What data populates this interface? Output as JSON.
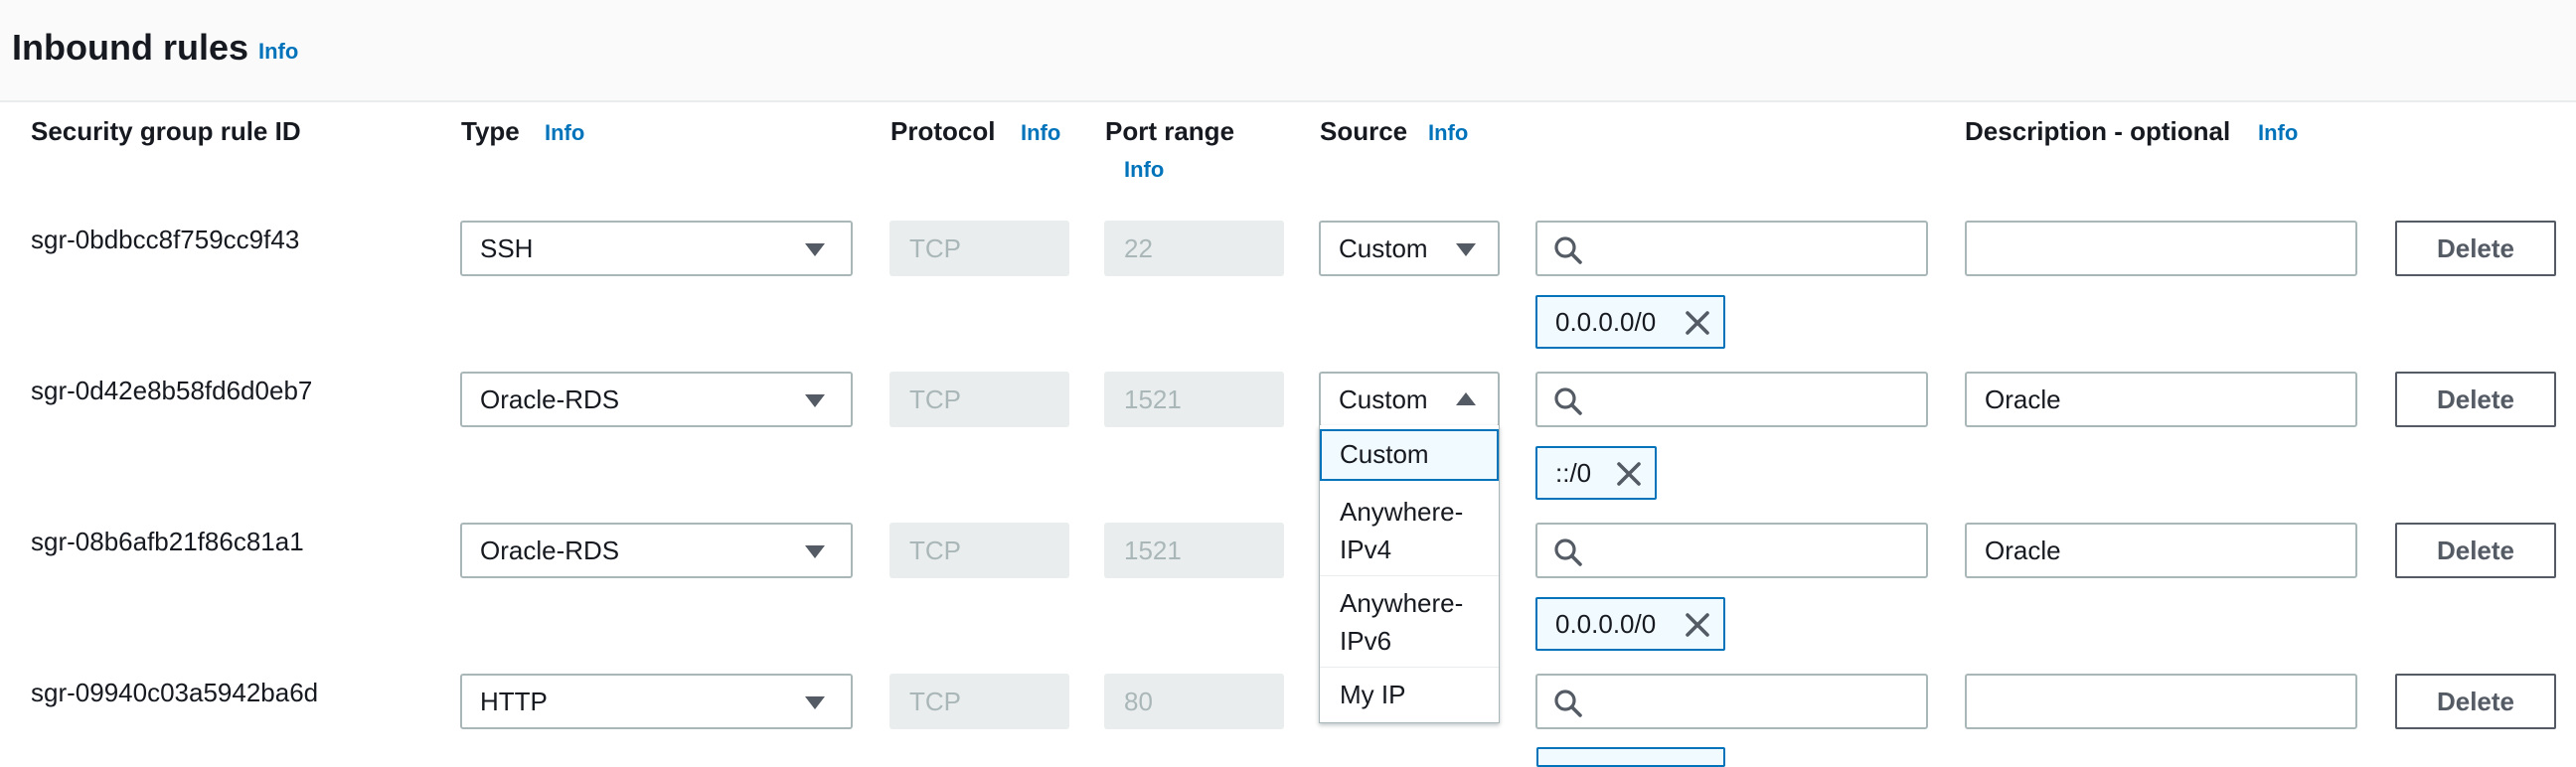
{
  "header": {
    "title": "Inbound rules",
    "info_label": "Info"
  },
  "columns": {
    "rule_id": "Security group rule ID",
    "type": "Type",
    "protocol": "Protocol",
    "port_range": "Port range",
    "source": "Source",
    "description": "Description - optional",
    "info_label": "Info"
  },
  "rows": [
    {
      "rule_id": "sgr-0bdbcc8f759cc9f43",
      "type": "SSH",
      "protocol": "TCP",
      "port_range": "22",
      "source_type": "Custom",
      "source_search": "",
      "cidr": "0.0.0.0/0",
      "description": "",
      "delete_label": "Delete"
    },
    {
      "rule_id": "sgr-0d42e8b58fd6d0eb7",
      "type": "Oracle-RDS",
      "protocol": "TCP",
      "port_range": "1521",
      "source_type": "Custom",
      "source_search": "",
      "cidr": "::/0",
      "description": "Oracle",
      "delete_label": "Delete"
    },
    {
      "rule_id": "sgr-08b6afb21f86c81a1",
      "type": "Oracle-RDS",
      "protocol": "TCP",
      "port_range": "1521",
      "source_type": "",
      "source_search": "",
      "cidr": "0.0.0.0/0",
      "description": "Oracle",
      "delete_label": "Delete"
    },
    {
      "rule_id": "sgr-09940c03a5942ba6d",
      "type": "HTTP",
      "protocol": "TCP",
      "port_range": "80",
      "source_type": "",
      "source_search": "",
      "cidr": "",
      "description": "",
      "delete_label": "Delete"
    }
  ],
  "source_dropdown": {
    "open_for_row": 1,
    "selected": "Custom",
    "options": [
      {
        "line1": "Custom",
        "line2": ""
      },
      {
        "line1": "Anywhere-",
        "line2": "IPv4"
      },
      {
        "line1": "Anywhere-",
        "line2": "IPv6"
      },
      {
        "line1": "My IP",
        "line2": ""
      }
    ]
  },
  "colors": {
    "info_link": "#0073bb",
    "chip_border": "#0073bb",
    "chip_background": "#f1faff",
    "readonly_background": "#eaeded",
    "input_border": "#aab7b8",
    "text": "#16191f"
  },
  "icons": {
    "dropdown": "caret-down-icon",
    "dropdown_open": "caret-up-icon",
    "search": "search-icon",
    "remove": "close-icon"
  }
}
